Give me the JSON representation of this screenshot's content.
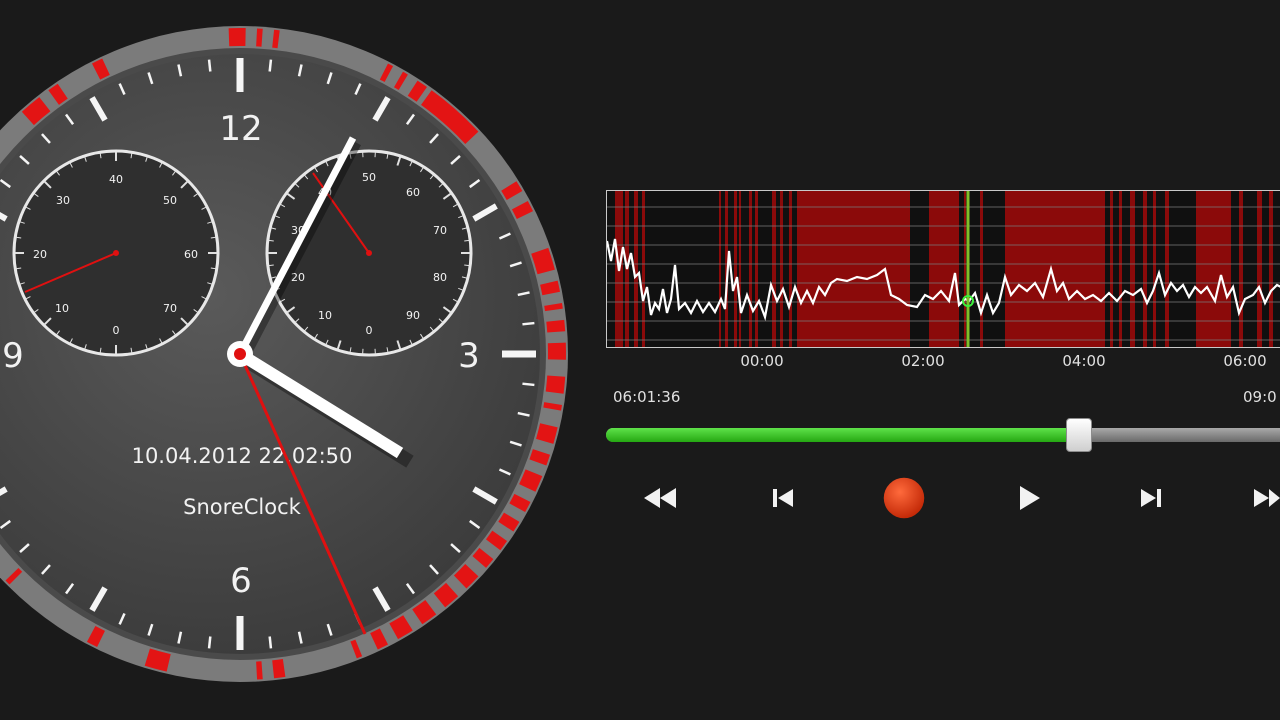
{
  "clock": {
    "numbers": {
      "twelve": "12",
      "three": "3",
      "six": "6",
      "nine": "9"
    },
    "datetime": "10.04.2012 22.02:50",
    "app_name": "SnoreClock",
    "left_dial": [
      "0",
      "10",
      "20",
      "30",
      "40",
      "50",
      "60",
      "70"
    ],
    "right_dial": [
      "0",
      "10",
      "20",
      "30",
      "40",
      "50",
      "60",
      "70",
      "80",
      "90"
    ]
  },
  "graph": {
    "time_labels": [
      "00:00",
      "02:00",
      "04:00",
      "06:00"
    ]
  },
  "playback": {
    "position_time": "06:01:36",
    "end_time": "09:0",
    "progress": 0.676
  },
  "controls": {
    "rewind": "rewind-icon",
    "previous": "skip-previous-icon",
    "record": "record-icon",
    "play": "play-icon",
    "next": "skip-next-icon",
    "fast_forward": "fast-forward-icon"
  },
  "colors": {
    "accent_red": "#e31414",
    "progress_green": "#2fbf1c",
    "record_red": "#e03a12",
    "graph_band_red": "#8b0a0a"
  }
}
